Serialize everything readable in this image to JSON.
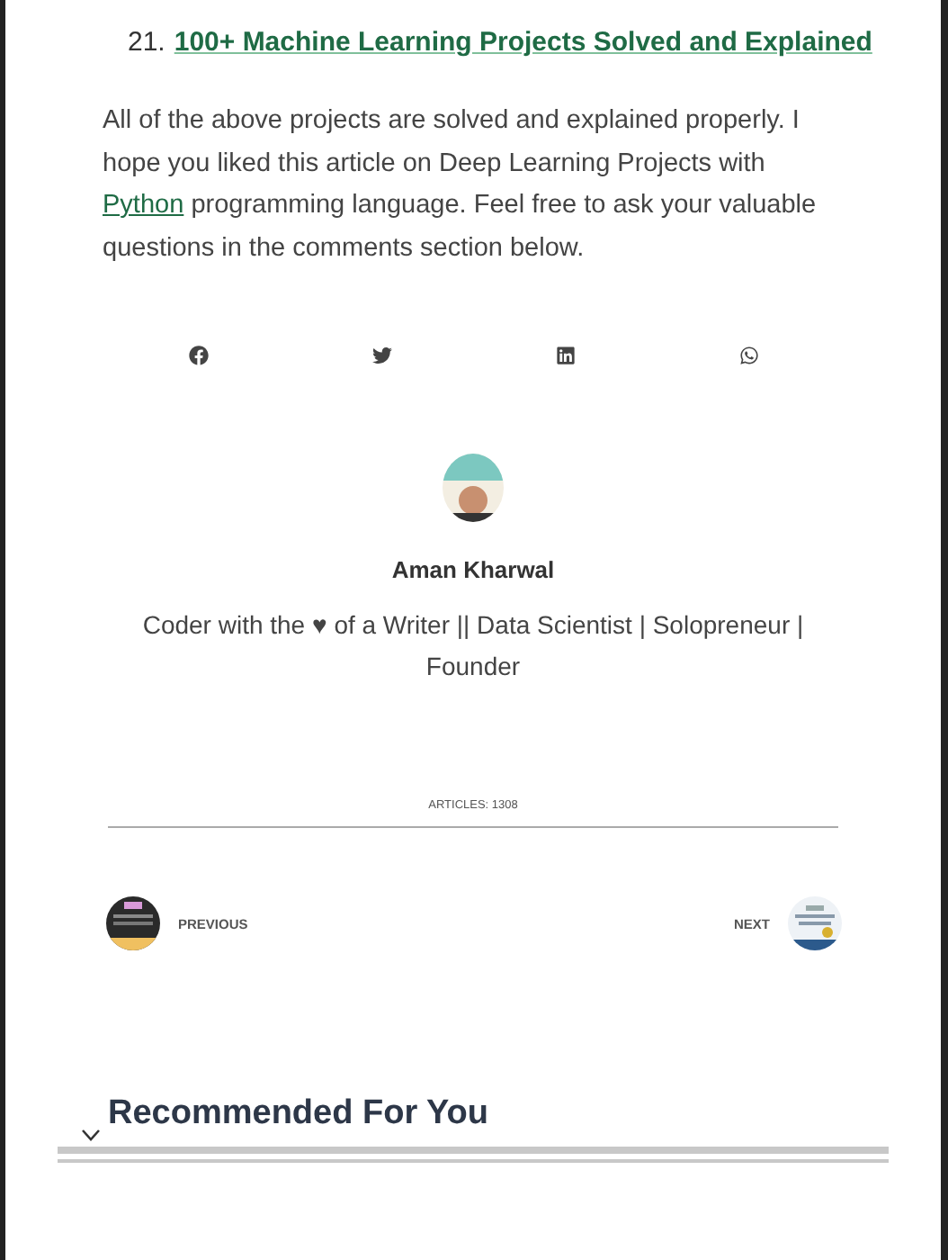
{
  "list_item": {
    "number": "21.",
    "link": "100+ Machine Learning Projects Solved and Explained"
  },
  "paragraph": {
    "before": "All of the above projects are solved and explained properly. I hope you liked this article on Deep Learning Projects with",
    "link": "Python",
    "after": "programming language. Feel free to ask your valuable questions in the comments section below."
  },
  "share_buttons": [
    {
      "kind": "facebook"
    },
    {
      "kind": "twitter"
    },
    {
      "kind": "linkedin"
    },
    {
      "kind": "whatsapp"
    }
  ],
  "author": {
    "name": "Aman Kharwal",
    "bio": "Coder with the ♥ of a Writer || Data Scientist | Solopreneur | Founder",
    "articles": "ARTICLES: 1308"
  },
  "navigation": {
    "previous": "PREVIOUS",
    "next": "NEXT"
  },
  "section_heading": "Recommended For You"
}
